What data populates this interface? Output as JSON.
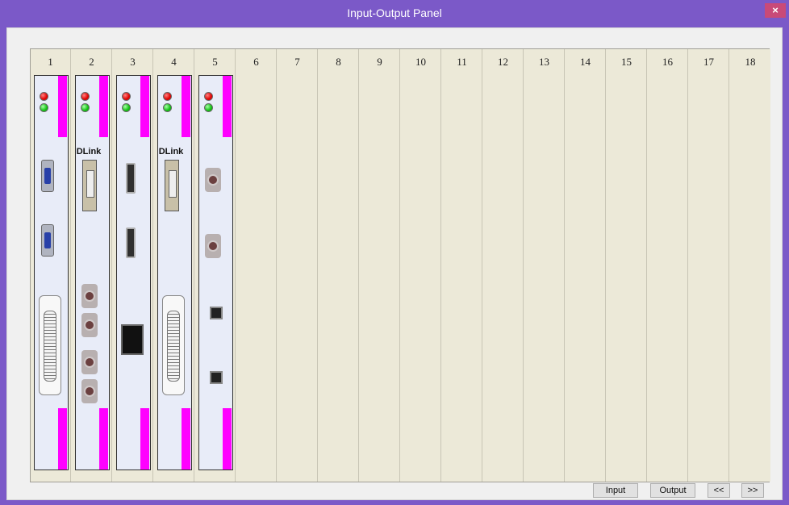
{
  "window": {
    "title": "Input-Output Panel",
    "close_label": "×"
  },
  "slots": [
    {
      "num": "1"
    },
    {
      "num": "2"
    },
    {
      "num": "3"
    },
    {
      "num": "4"
    },
    {
      "num": "5"
    },
    {
      "num": "6"
    },
    {
      "num": "7"
    },
    {
      "num": "8"
    },
    {
      "num": "9"
    },
    {
      "num": "10"
    },
    {
      "num": "11"
    },
    {
      "num": "12"
    },
    {
      "num": "13"
    },
    {
      "num": "14"
    },
    {
      "num": "15"
    },
    {
      "num": "16"
    },
    {
      "num": "17"
    },
    {
      "num": "18"
    }
  ],
  "cards": {
    "slot2_brand": "DLink",
    "slot4_brand": "DLink"
  },
  "buttons": {
    "input": "Input",
    "output": "Output",
    "prev": "<<",
    "next": ">>"
  },
  "colors": {
    "titlebar": "#7b59c8",
    "card_stripe": "#ff00ff",
    "led_red": "#e00000",
    "led_green": "#10c010"
  }
}
